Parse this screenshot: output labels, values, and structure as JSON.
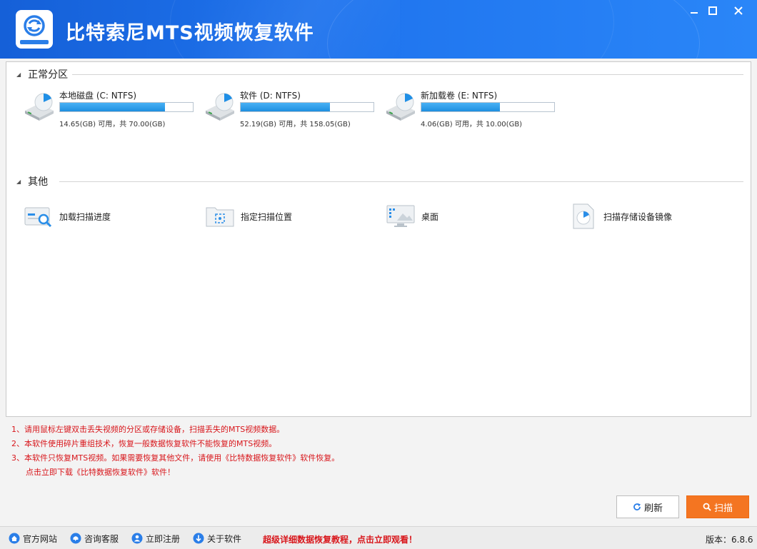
{
  "app": {
    "title": "比特索尼MTS视频恢复软件"
  },
  "window_controls": {
    "minimize": "—",
    "maximize": "☐",
    "close": "✕"
  },
  "sections": {
    "normal_partitions": "正常分区",
    "other": "其他"
  },
  "drives": [
    {
      "name": "本地磁盘 (C: NTFS)",
      "size_text": "14.65(GB) 可用，共 70.00(GB)",
      "used_fraction": 0.79
    },
    {
      "name": "软件 (D: NTFS)",
      "size_text": "52.19(GB) 可用，共 158.05(GB)",
      "used_fraction": 0.67
    },
    {
      "name": "新加载卷 (E: NTFS)",
      "size_text": "4.06(GB) 可用，共 10.00(GB)",
      "used_fraction": 0.59
    }
  ],
  "other_items": [
    {
      "label": "加载扫描进度",
      "icon": "scan-progress-icon"
    },
    {
      "label": "指定扫描位置",
      "icon": "folder-target-icon"
    },
    {
      "label": "桌面",
      "icon": "desktop-icon"
    },
    {
      "label": "扫描存储设备镜像",
      "icon": "disk-image-icon"
    }
  ],
  "notes": [
    "1、请用鼠标左键双击丢失视频的分区或存储设备，扫描丢失的MTS视频数据。",
    "2、本软件使用碎片重组技术，恢复一般数据恢复软件不能恢复的MTS视频。",
    "3、本软件只恢复MTS视频。如果需要恢复其他文件，请使用《比特数据恢复软件》软件恢复。",
    "点击立即下载《比特数据恢复软件》软件！"
  ],
  "buttons": {
    "refresh": "刷新",
    "scan": "扫描"
  },
  "statusbar": {
    "website": "官方网站",
    "support": "咨询客服",
    "register": "立即注册",
    "about": "关于软件",
    "promo": "超级详细数据恢复教程，点击立即观看！",
    "version": "版本：6.8.6"
  },
  "colors": {
    "title_bar": "#1f74ee",
    "progress": "#1e8fe0",
    "scan_button": "#f47521",
    "notes_text": "#d8161b"
  }
}
